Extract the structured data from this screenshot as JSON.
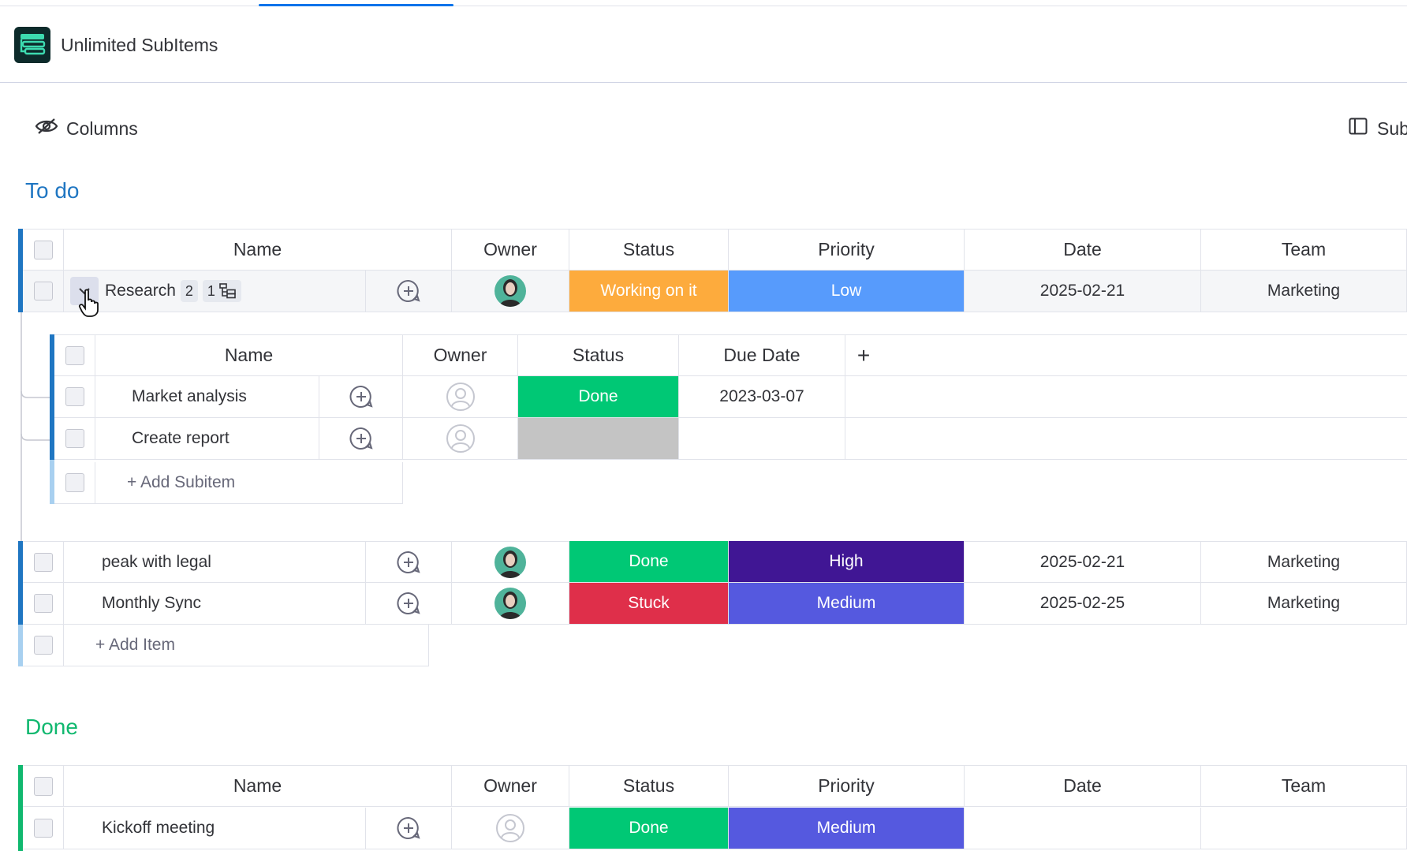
{
  "app": {
    "title": "Unlimited SubItems"
  },
  "toolbar": {
    "columns_label": "Columns",
    "sub_label": "Sub"
  },
  "colors": {
    "accent": "#0073ea",
    "todo_group": "#1f76c2",
    "done_group": "#10b86f",
    "working": "#fdab3d",
    "done": "#00c875",
    "stuck": "#df2f4a",
    "empty": "#c4c4c4",
    "low": "#579bfc",
    "medium": "#5559df",
    "high": "#401694"
  },
  "groups": {
    "todo": {
      "title": "To do",
      "headers": {
        "name": "Name",
        "owner": "Owner",
        "status": "Status",
        "priority": "Priority",
        "date": "Date",
        "team": "Team"
      },
      "items": [
        {
          "name": "Research",
          "subitem_count": "2",
          "subtree_count": "1",
          "status": "Working on it",
          "priority": "Low",
          "date": "2025-02-21",
          "team": "Marketing"
        },
        {
          "name": "peak with legal",
          "status": "Done",
          "priority": "High",
          "date": "2025-02-21",
          "team": "Marketing"
        },
        {
          "name": "Monthly Sync",
          "status": "Stuck",
          "priority": "Medium",
          "date": "2025-02-25",
          "team": "Marketing"
        }
      ],
      "add_item": "+ Add Item",
      "subitems": {
        "headers": {
          "name": "Name",
          "owner": "Owner",
          "status": "Status",
          "due_date": "Due Date",
          "add_column": "+"
        },
        "rows": [
          {
            "name": "Market analysis",
            "status": "Done",
            "due_date": "2023-03-07"
          },
          {
            "name": "Create report",
            "status": "",
            "due_date": ""
          }
        ],
        "add_subitem": "+ Add Subitem"
      }
    },
    "done": {
      "title": "Done",
      "headers": {
        "name": "Name",
        "owner": "Owner",
        "status": "Status",
        "priority": "Priority",
        "date": "Date",
        "team": "Team"
      },
      "items": [
        {
          "name": "Kickoff meeting",
          "status": "Done",
          "priority": "Medium",
          "date": "",
          "team": ""
        }
      ]
    }
  }
}
